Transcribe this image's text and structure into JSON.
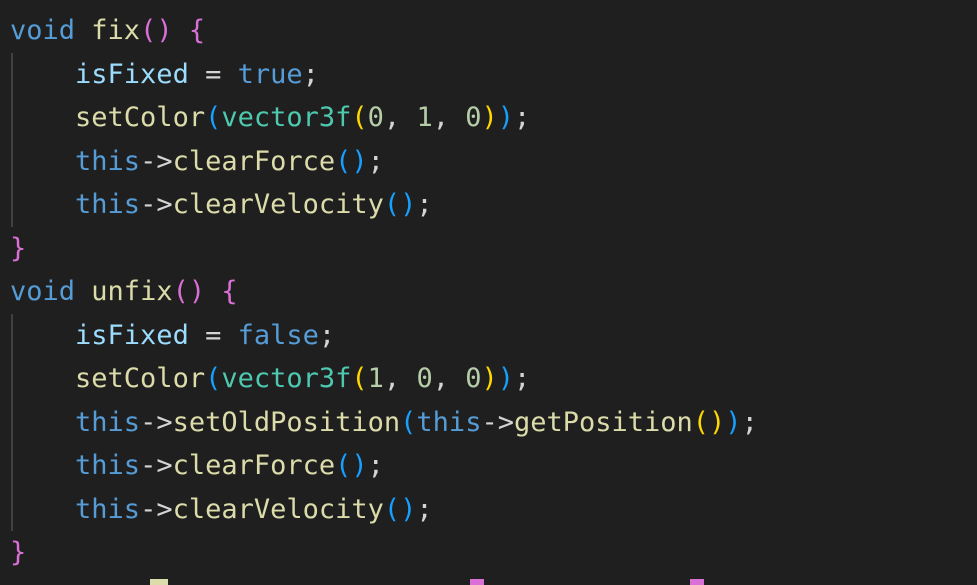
{
  "editor": {
    "theme_colors": {
      "background": "#1f1f1f",
      "keyword": "#569cd6",
      "function": "#dcdcaa",
      "variable": "#9cdcfe",
      "type": "#4ec9b0",
      "number": "#b5cea8",
      "bracket_level_1": "#da70d6",
      "bracket_level_2": "#179fff",
      "bracket_level_3": "#ffd700"
    },
    "lines": [
      {
        "guide": false,
        "tokens": [
          {
            "t": "void",
            "c": "kw"
          },
          {
            "t": " ",
            "c": "op"
          },
          {
            "t": "fix",
            "c": "fn"
          },
          {
            "t": "()",
            "c": "p1"
          },
          {
            "t": " ",
            "c": "op"
          },
          {
            "t": "{",
            "c": "p1"
          }
        ]
      },
      {
        "guide": true,
        "tokens": [
          {
            "t": "    ",
            "c": "op"
          },
          {
            "t": "isFixed",
            "c": "var"
          },
          {
            "t": " = ",
            "c": "op"
          },
          {
            "t": "true",
            "c": "kw"
          },
          {
            "t": ";",
            "c": "op"
          }
        ]
      },
      {
        "guide": true,
        "tokens": [
          {
            "t": "    ",
            "c": "op"
          },
          {
            "t": "setColor",
            "c": "fn"
          },
          {
            "t": "(",
            "c": "p2"
          },
          {
            "t": "vector3f",
            "c": "type"
          },
          {
            "t": "(",
            "c": "p3"
          },
          {
            "t": "0",
            "c": "num"
          },
          {
            "t": ", ",
            "c": "op"
          },
          {
            "t": "1",
            "c": "num"
          },
          {
            "t": ", ",
            "c": "op"
          },
          {
            "t": "0",
            "c": "num"
          },
          {
            "t": ")",
            "c": "p3"
          },
          {
            "t": ")",
            "c": "p2"
          },
          {
            "t": ";",
            "c": "op"
          }
        ]
      },
      {
        "guide": true,
        "tokens": [
          {
            "t": "    ",
            "c": "op"
          },
          {
            "t": "this",
            "c": "kw"
          },
          {
            "t": "->",
            "c": "op"
          },
          {
            "t": "clearForce",
            "c": "fn"
          },
          {
            "t": "()",
            "c": "p2"
          },
          {
            "t": ";",
            "c": "op"
          }
        ]
      },
      {
        "guide": true,
        "tokens": [
          {
            "t": "    ",
            "c": "op"
          },
          {
            "t": "this",
            "c": "kw"
          },
          {
            "t": "->",
            "c": "op"
          },
          {
            "t": "clearVelocity",
            "c": "fn"
          },
          {
            "t": "()",
            "c": "p2"
          },
          {
            "t": ";",
            "c": "op"
          }
        ]
      },
      {
        "guide": false,
        "tokens": [
          {
            "t": "}",
            "c": "p1"
          }
        ]
      },
      {
        "guide": false,
        "tokens": [
          {
            "t": "void",
            "c": "kw"
          },
          {
            "t": " ",
            "c": "op"
          },
          {
            "t": "unfix",
            "c": "fn"
          },
          {
            "t": "()",
            "c": "p1"
          },
          {
            "t": " ",
            "c": "op"
          },
          {
            "t": "{",
            "c": "p1"
          }
        ]
      },
      {
        "guide": true,
        "tokens": [
          {
            "t": "    ",
            "c": "op"
          },
          {
            "t": "isFixed",
            "c": "var"
          },
          {
            "t": " = ",
            "c": "op"
          },
          {
            "t": "false",
            "c": "kw"
          },
          {
            "t": ";",
            "c": "op"
          }
        ]
      },
      {
        "guide": true,
        "tokens": [
          {
            "t": "    ",
            "c": "op"
          },
          {
            "t": "setColor",
            "c": "fn"
          },
          {
            "t": "(",
            "c": "p2"
          },
          {
            "t": "vector3f",
            "c": "type"
          },
          {
            "t": "(",
            "c": "p3"
          },
          {
            "t": "1",
            "c": "num"
          },
          {
            "t": ", ",
            "c": "op"
          },
          {
            "t": "0",
            "c": "num"
          },
          {
            "t": ", ",
            "c": "op"
          },
          {
            "t": "0",
            "c": "num"
          },
          {
            "t": ")",
            "c": "p3"
          },
          {
            "t": ")",
            "c": "p2"
          },
          {
            "t": ";",
            "c": "op"
          }
        ]
      },
      {
        "guide": true,
        "tokens": [
          {
            "t": "    ",
            "c": "op"
          },
          {
            "t": "this",
            "c": "kw"
          },
          {
            "t": "->",
            "c": "op"
          },
          {
            "t": "setOldPosition",
            "c": "fn"
          },
          {
            "t": "(",
            "c": "p2"
          },
          {
            "t": "this",
            "c": "kw"
          },
          {
            "t": "->",
            "c": "op"
          },
          {
            "t": "getPosition",
            "c": "fn"
          },
          {
            "t": "()",
            "c": "p3"
          },
          {
            "t": ")",
            "c": "p2"
          },
          {
            "t": ";",
            "c": "op"
          }
        ]
      },
      {
        "guide": true,
        "tokens": [
          {
            "t": "    ",
            "c": "op"
          },
          {
            "t": "this",
            "c": "kw"
          },
          {
            "t": "->",
            "c": "op"
          },
          {
            "t": "clearForce",
            "c": "fn"
          },
          {
            "t": "()",
            "c": "p2"
          },
          {
            "t": ";",
            "c": "op"
          }
        ]
      },
      {
        "guide": true,
        "tokens": [
          {
            "t": "    ",
            "c": "op"
          },
          {
            "t": "this",
            "c": "kw"
          },
          {
            "t": "->",
            "c": "op"
          },
          {
            "t": "clearVelocity",
            "c": "fn"
          },
          {
            "t": "()",
            "c": "p2"
          },
          {
            "t": ";",
            "c": "op"
          }
        ]
      },
      {
        "guide": false,
        "tokens": [
          {
            "t": "}",
            "c": "p1"
          }
        ]
      }
    ]
  }
}
